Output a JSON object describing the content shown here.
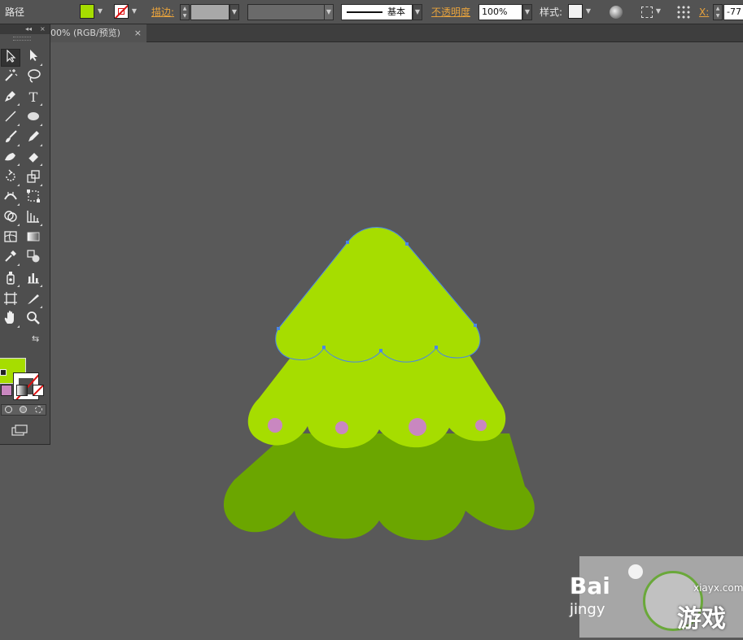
{
  "control": {
    "object_type": "路径",
    "stroke_label": "描边:",
    "stroke_profile": "基本",
    "opacity_label": "不透明度",
    "opacity_value": "100%",
    "style_label": "样式:",
    "x_label": "X:",
    "x_value": "-77"
  },
  "tab": {
    "title": "00% (RGB/预览)",
    "close": "×"
  },
  "tools": {
    "collapse": "◂◂",
    "close": "×",
    "type_tool": "T"
  },
  "colors": {
    "fill": "#a6dd00",
    "tree_light": "#a6dd00",
    "tree_dark": "#6ba600",
    "ornament": "#c987c0",
    "selection": "#4a86e8",
    "canvas": "#595959"
  },
  "watermark": {
    "brand": "Bai",
    "sub": "jingy",
    "site": "xiayx.com",
    "game": "游戏"
  }
}
